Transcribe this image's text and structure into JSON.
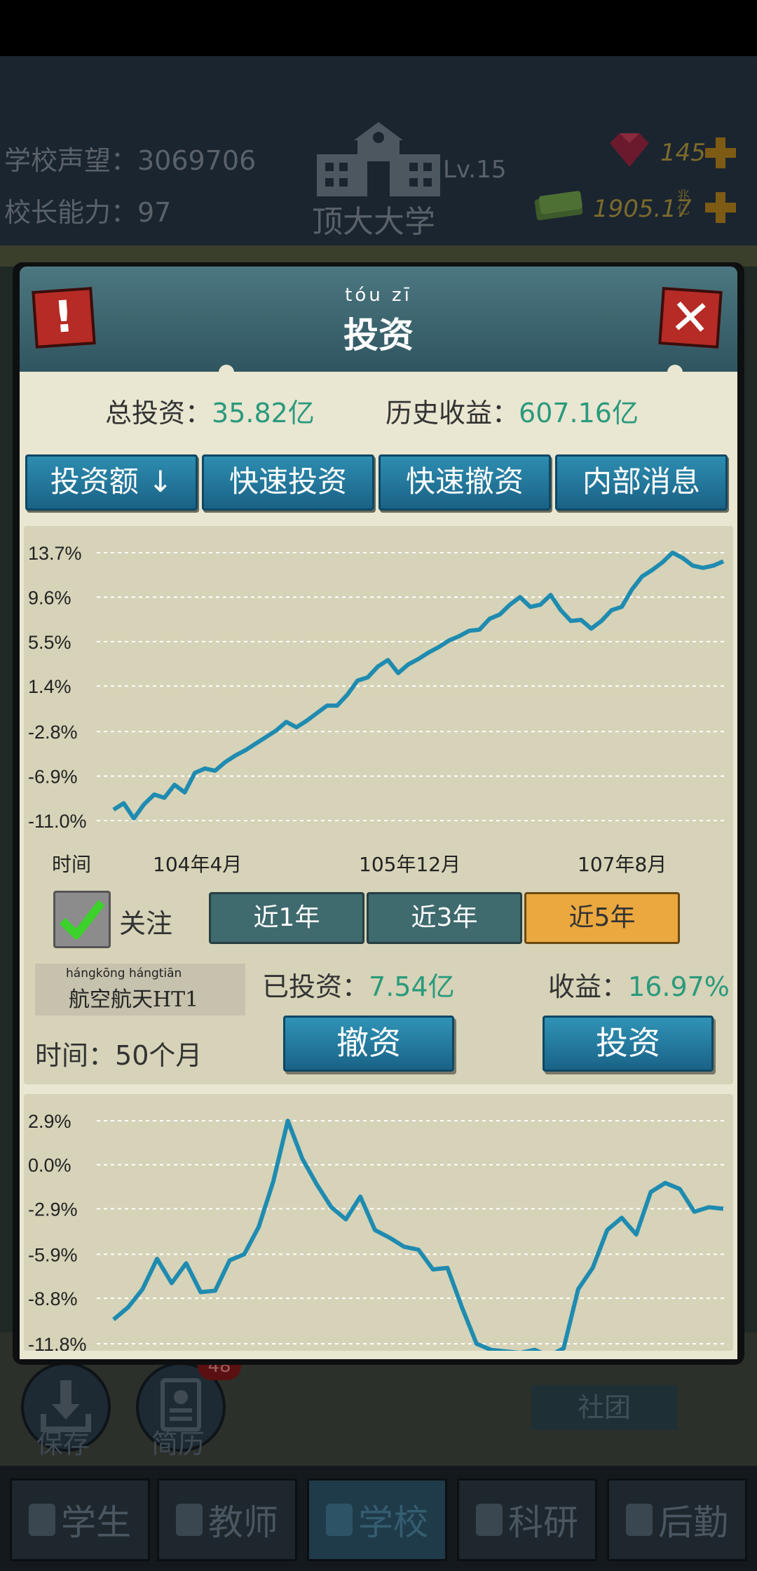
{
  "hud": {
    "reputation": "学校声望：3069706",
    "principal_ability": "校长能力：97",
    "school_name": "顶大大学",
    "level": "Lv.15",
    "gems": "145",
    "money": "1905.17",
    "money_unit_top": "兆",
    "money_unit_bottom": "亿"
  },
  "background": {
    "save_label": "保存",
    "resume_label": "简历",
    "resume_badge": "48",
    "club_label": "社团"
  },
  "nav": {
    "items": [
      {
        "label": "学生",
        "icon": "student-icon"
      },
      {
        "label": "教师",
        "icon": "teacher-icon"
      },
      {
        "label": "学校",
        "icon": "school-icon",
        "active": true
      },
      {
        "label": "科研",
        "icon": "flask-icon"
      },
      {
        "label": "后勤",
        "icon": "clipboard-icon"
      }
    ]
  },
  "panel": {
    "title_pinyin": "tóu  zī",
    "title": "投资",
    "alert_icon": "!",
    "close_icon": "✕",
    "total_invest_label": "总投资：",
    "total_invest_value": "35.82亿",
    "history_profit_label": "历史收益：",
    "history_profit_value": "607.16亿",
    "tabs": [
      "投资额 ↓",
      "快速投资",
      "快速撤资",
      "内部消息"
    ],
    "follow_label": "关注",
    "follow_checked": true,
    "ranges": [
      "近1年",
      "近3年",
      "近5年"
    ],
    "selected_range": "近5年",
    "stock_pinyin": "hángkōng hángtiān",
    "stock_name": "航空航天HT1",
    "invested_label": "已投资：",
    "invested_value": "7.54亿",
    "return_label": "收益：",
    "return_value": "16.97%",
    "time_label": "时间：",
    "time_value": "50个月",
    "withdraw_label": "撤资",
    "invest_label": "投资",
    "accent_green": "#2a9a7c",
    "line_color": "#1f8bb0"
  },
  "chart_data": [
    {
      "type": "line",
      "title": "",
      "xlabel": "时间",
      "ylabel": "",
      "ylim": [
        -11.0,
        13.7
      ],
      "yticks": [
        "13.7%",
        "9.6%",
        "5.5%",
        "1.4%",
        "-2.8%",
        "-6.9%",
        "-11.0%"
      ],
      "ytick_values": [
        13.7,
        9.6,
        5.5,
        1.4,
        -2.8,
        -6.9,
        -11.0
      ],
      "xticks": [
        "104年4月",
        "105年12月",
        "107年8月"
      ],
      "grid": true,
      "series": [
        {
          "values": [
            -10.0,
            -9.4,
            -10.8,
            -9.5,
            -8.6,
            -8.9,
            -7.7,
            -8.4,
            -6.6,
            -6.2,
            -6.4,
            -5.6,
            -5.0,
            -4.5,
            -3.9,
            -3.3,
            -2.7,
            -1.9,
            -2.4,
            -1.8,
            -1.1,
            -0.4,
            -0.4,
            0.6,
            1.9,
            2.2,
            3.2,
            3.8,
            2.6,
            3.4,
            3.9,
            4.5,
            5.0,
            5.6,
            6.0,
            6.5,
            6.6,
            7.6,
            8.0,
            8.9,
            9.6,
            8.7,
            8.9,
            9.8,
            8.4,
            7.4,
            7.5,
            6.7,
            7.4,
            8.4,
            8.7,
            10.3,
            11.5,
            12.1,
            12.8,
            13.7,
            13.2,
            12.5,
            12.3,
            12.5,
            12.9
          ]
        }
      ]
    },
    {
      "type": "line",
      "title": "",
      "xlabel": "",
      "ylabel": "",
      "ylim": [
        -11.8,
        2.9
      ],
      "yticks": [
        "2.9%",
        "0.0%",
        "-2.9%",
        "-5.9%",
        "-8.8%",
        "-11.8%"
      ],
      "ytick_values": [
        2.9,
        0.0,
        -2.9,
        -5.9,
        -8.8,
        -11.8
      ],
      "grid": true,
      "series": [
        {
          "values": [
            -10.2,
            -9.4,
            -8.2,
            -6.2,
            -7.8,
            -6.5,
            -8.4,
            -8.3,
            -6.3,
            -5.9,
            -4.1,
            -1.1,
            2.9,
            0.4,
            -1.3,
            -2.8,
            -3.6,
            -2.1,
            -4.3,
            -4.8,
            -5.4,
            -5.6,
            -6.9,
            -6.8,
            -9.4,
            -11.8,
            -12.2,
            -12.3,
            -12.4,
            -12.2,
            -12.6,
            -12.1,
            -8.2,
            -6.8,
            -4.3,
            -3.5,
            -4.6,
            -1.8,
            -1.2,
            -1.6,
            -3.1,
            -2.8,
            -2.9
          ]
        }
      ]
    }
  ]
}
